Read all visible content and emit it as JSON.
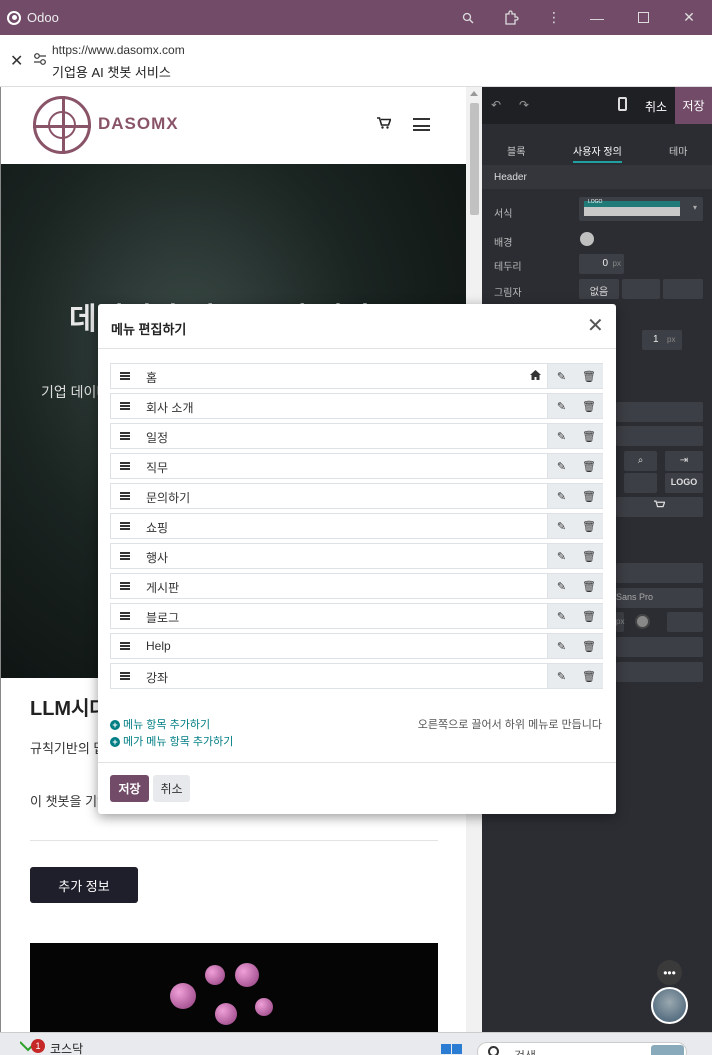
{
  "window": {
    "title": "Odoo"
  },
  "urlbar": {
    "url": "https://www.dasomx.com",
    "page_title": "기업용 AI 챗봇 서비스"
  },
  "site": {
    "logo_text": "DASOMX",
    "hero_title": "데이터가 있는 곳에 해법도",
    "hero_sub": "기업 데이터",
    "section_title": "LLM시대",
    "para1": "규칙기반의 답변을 생성합",
    "para2": "이 챗봇을 기업 접근할 수 있게 됩니다.",
    "more_button": "추가 정보"
  },
  "editor": {
    "cancel": "취소",
    "save": "저장",
    "tabs": [
      "블록",
      "사용자 정의",
      "테마"
    ],
    "section": "Header",
    "labels": {
      "format": "서식",
      "background": "배경",
      "border": "테두리",
      "shadow": "그림자"
    },
    "border_value": "0",
    "border_unit": "px",
    "shadow_value": "없음",
    "border_width_value": "1",
    "border_width_unit": "px",
    "logo_button": "LOGO",
    "preview_logo": "LOGO",
    "font_value": "Sans Pro",
    "size_unit": "px"
  },
  "modal": {
    "title": "메뉴 편집하기",
    "items": [
      {
        "label": "홈"
      },
      {
        "label": "회사 소개"
      },
      {
        "label": "일정"
      },
      {
        "label": "직무"
      },
      {
        "label": "문의하기"
      },
      {
        "label": "쇼핑"
      },
      {
        "label": "행사"
      },
      {
        "label": "게시판"
      },
      {
        "label": "블로그"
      },
      {
        "label": "Help"
      },
      {
        "label": "강좌"
      }
    ],
    "add_menu_item": "메뉴 항목 추가하기",
    "add_mega_menu_item": "메가 메뉴 항목 추가하기",
    "hint": "오른쪽으로 끌어서 하위 메뉴로 만듭니다",
    "save": "저장",
    "cancel": "취소"
  },
  "taskbar": {
    "app_label": "코스닥",
    "badge": "1",
    "search_placeholder": "검색"
  },
  "colors": {
    "brand": "#714b67",
    "link": "#017e84",
    "logo": "#8a5468"
  }
}
